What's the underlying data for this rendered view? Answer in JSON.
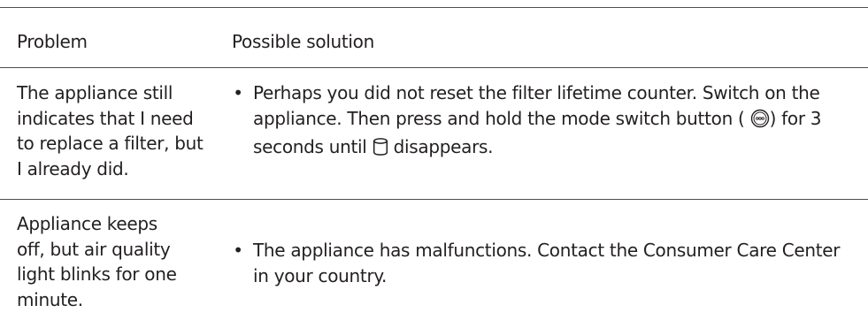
{
  "table": {
    "headers": {
      "problem": "Problem",
      "solution": "Possible solution"
    },
    "rows": [
      {
        "problem": "The appliance still indicates that I need to replace a filter, but I already did.",
        "problem_lines": [
          "The appliance still",
          "indicates that I need",
          "to replace a filter, but",
          "I already did."
        ],
        "solution_bullet": "•",
        "solution_part1": "Perhaps you did not reset the filter lifetime counter. Switch on the appliance. Then press and hold the mode switch button (",
        "solution_part2": ") for 3 seconds until",
        "solution_part3": "disappears.",
        "icons": [
          "mode-switch-button-icon",
          "filter-icon"
        ]
      },
      {
        "problem": "Appliance keeps off, but air quality light blinks for one minute.",
        "problem_lines": [
          "Appliance keeps",
          "off, but air quality",
          "light blinks for one",
          "minute."
        ],
        "solution_bullet": "•",
        "solution": "The appliance has malfunctions. Contact the Consumer Care Center in your country."
      }
    ]
  },
  "colors": {
    "text": "#231f20",
    "rule": "#4d4d4f"
  }
}
